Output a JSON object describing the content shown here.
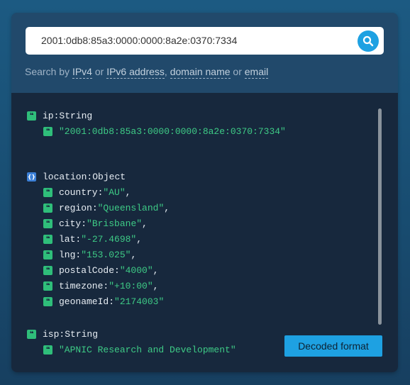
{
  "search": {
    "value": "2001:0db8:85a3:0000:0000:8a2e:0370:7334",
    "button_icon": "search-icon"
  },
  "hint": {
    "prefix": "Search by ",
    "ipv4": "IPv4",
    "or1": " or ",
    "ipv6": "IPv6 address",
    "comma": ", ",
    "domain": "domain name",
    "or2": " or ",
    "email": "email"
  },
  "result": {
    "ip": {
      "key": "ip",
      "type": "String",
      "value": "\"2001:0db8:85a3:0000:0000:8a2e:0370:7334\""
    },
    "location": {
      "key": "location",
      "type": "Object",
      "fields": [
        {
          "key": "country",
          "value": "\"AU\""
        },
        {
          "key": "region",
          "value": "\"Queensland\""
        },
        {
          "key": "city",
          "value": "\"Brisbane\""
        },
        {
          "key": "lat",
          "value": "\"-27.4698\""
        },
        {
          "key": "lng",
          "value": "\"153.025\""
        },
        {
          "key": "postalCode",
          "value": "\"4000\""
        },
        {
          "key": "timezone",
          "value": "\"+10:00\""
        },
        {
          "key": "geonameId",
          "value": "\"2174003\""
        }
      ]
    },
    "isp": {
      "key": "isp",
      "type": "String",
      "value": "\"APNIC Research and Development\""
    }
  },
  "symbols": {
    "string_badge": "❝",
    "object_badge": "{}",
    "colon": ": ",
    "comma": ","
  },
  "decode_button": "Decoded format",
  "colors": {
    "accent": "#1ea1e2",
    "string_value": "#3ecb86",
    "panel": "#17283d"
  }
}
